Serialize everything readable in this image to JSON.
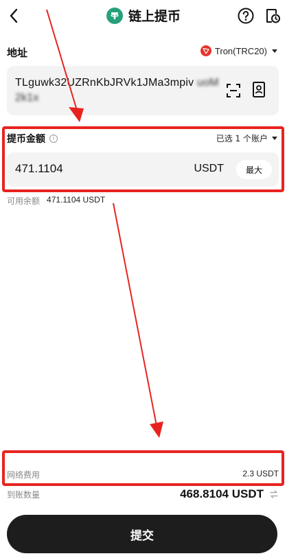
{
  "header": {
    "title": "链上提币",
    "back_icon": "chevron-left-icon",
    "help_icon": "question-circle-icon",
    "history_icon": "document-clock-icon"
  },
  "address": {
    "label": "地址",
    "network": "Tron(TRC20)",
    "value_visible": "TLguwk32UZRnKbJRVk1JMa3mpiv",
    "value_blurred": "uoM2k1x"
  },
  "amount": {
    "label": "提币金额",
    "account_selector": "已选 1 个账户",
    "value": "471.1104",
    "unit": "USDT",
    "max_label": "最大"
  },
  "available": {
    "label": "可用余额",
    "value": "471.1104 USDT"
  },
  "fee": {
    "label": "网络费用",
    "value": "2.3 USDT"
  },
  "receive": {
    "label": "到账数量",
    "value": "468.8104 USDT"
  },
  "submit_label": "提交",
  "colors": {
    "accent": "#1d1d1d",
    "tether": "#26a17b",
    "tron": "#e8322b",
    "annotation": "#e8231f"
  }
}
